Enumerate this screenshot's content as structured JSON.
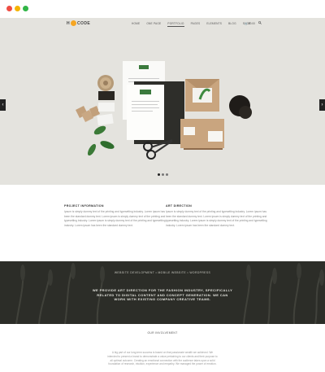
{
  "nav": {
    "logo": {
      "left": "H",
      "right": "CODE"
    },
    "items": [
      "HOME",
      "ONE PAGE",
      "PORTFOLIO",
      "PAGES",
      "ELEMENTS",
      "BLOG",
      "SHOP"
    ],
    "active_item": "PORTFOLIO",
    "cart": "$0.00"
  },
  "hero": {
    "brand_name": "GARDENIA",
    "slider_dots": 3,
    "active_dot": 1
  },
  "project_info": {
    "title": "PROJECT INFORMATION",
    "body": "Ipsum is simply dummy text of the printing and typesetting industry. Lorem ipsum has been the standard dummy text. Lorem ipsum is simply dummy text of the printing and typesetting industry. Lorem ipsum is simply dummy text of the printing and typesetting industry. Lorem ipsum has been the standard dummy text."
  },
  "art_direction": {
    "title": "ART DIRECTION",
    "body": "Ipsum is simply dummy text of the printing and typesetting industry. Lorem ipsum has been the standard dummy text. Lorem ipsum is simply dummy text of the printing and typesetting industry. Lorem ipsum is simply dummy text of the printing and typesetting industry. Lorem ipsum has been the standard dummy text."
  },
  "dark_band": {
    "tags": "WEBSITE DEVELOPMENT • MOBILE WEBSITE • WORDPRESS",
    "statement": "WE PROVIDE ART DIRECTION FOR THE FASHION INDUSTRY, SPECIFICALLY RELATED TO DIGITAL CONTENT AND CONCEPT GENERATION. WE CAN WORK WITH EXISTING COMPANY CREATIVE TEAMS."
  },
  "involvement": {
    "title": "OUR INVOLVEMENT",
    "body": "A big part of our long-term success is based on that passionate wealth we achieved. We intended to present a brand to demonstrate a value pertaining to our clients and their purpose to all optimal outcome. Creating an emotional connection with the audience takes upon a solid foundation of research, intuition, experience and empathy. We managed the power of emotion."
  },
  "colors": {
    "hero_bg": "#e4e3de",
    "dark_band": "#2c2d28",
    "logo_accent": "#f6a623"
  }
}
